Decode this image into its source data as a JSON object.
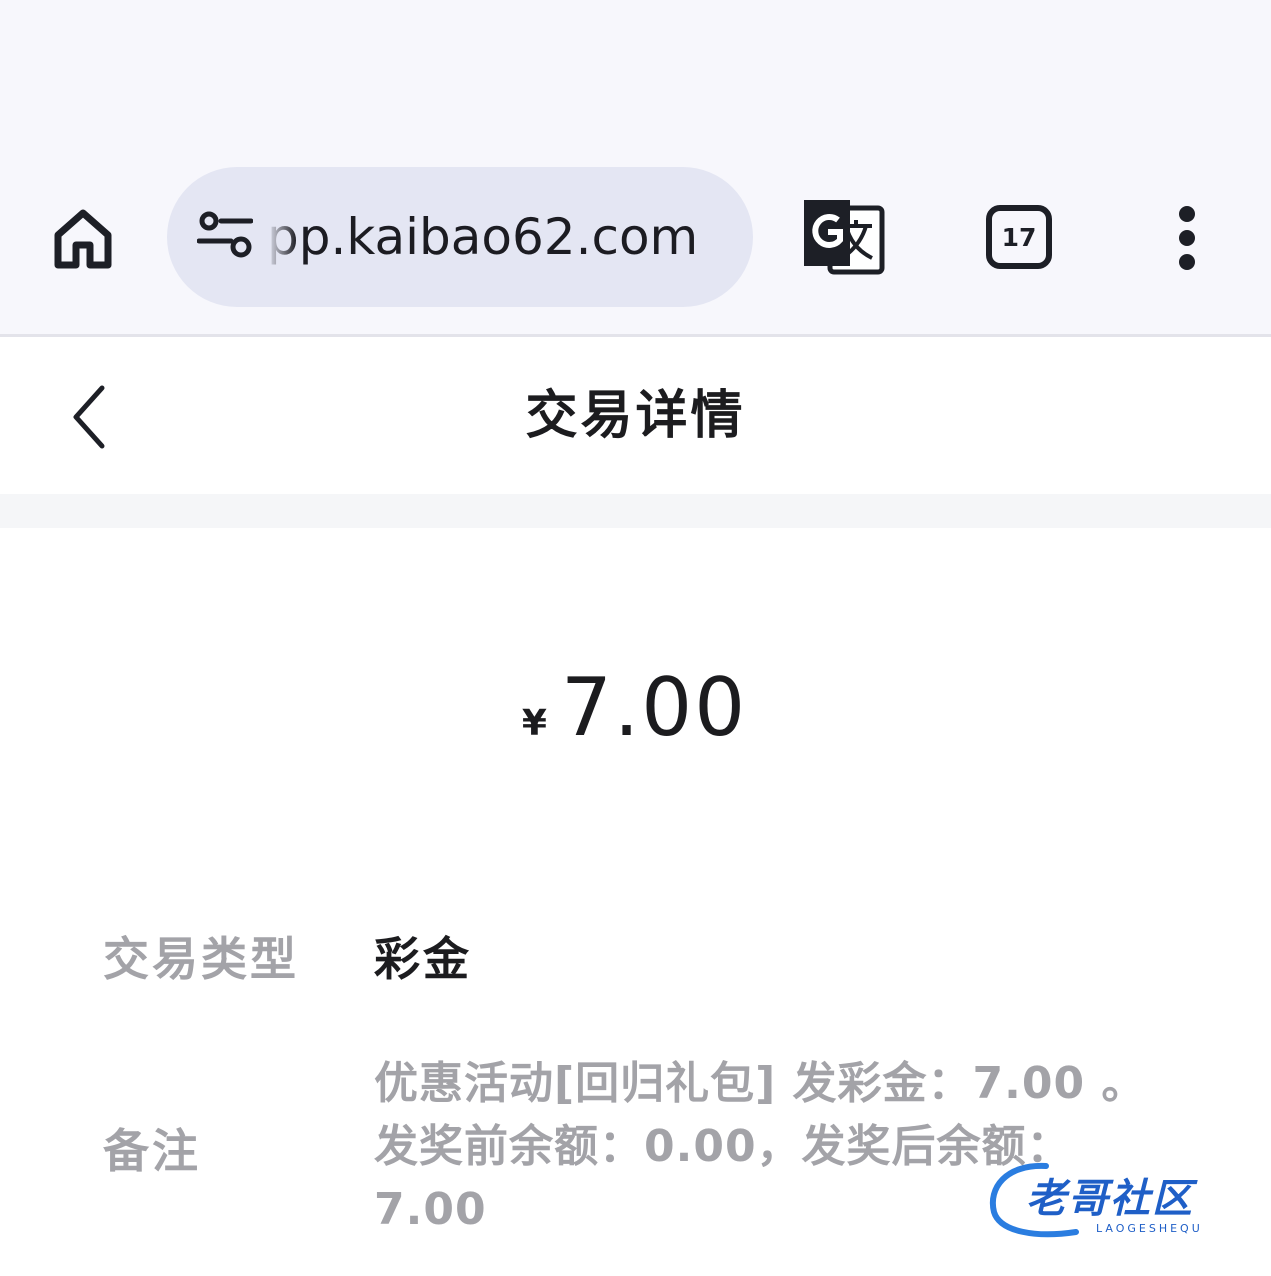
{
  "browser": {
    "url": "pp.kaibao62.com",
    "tab_count": "17",
    "icons": {
      "home": "home-icon",
      "site_settings": "tune-icon",
      "translate": "translate-icon",
      "tabs": "tab-switcher-icon",
      "menu": "more-vert-icon"
    }
  },
  "header": {
    "title": "交易详情",
    "back_icon": "chevron-left-icon"
  },
  "amount": {
    "currency": "¥",
    "value": "7.00"
  },
  "details": {
    "type_label": "交易类型",
    "type_value": "彩金",
    "note_label": "备注",
    "note_lines": [
      "优惠活动[回归礼包] 发彩金：7.00 。",
      "发奖前余额：0.00，发奖后余额：",
      "7.00"
    ]
  },
  "watermark": {
    "text": "老哥社区",
    "sub": "LAOGESHEQU"
  },
  "colors": {
    "chrome_bg": "#f7f7fc",
    "url_pill": "#e4e6f3",
    "text_primary": "#1c1c1f",
    "text_secondary": "#a3a3a8",
    "divider": "#f5f6f8",
    "watermark": "#1f5fc7"
  }
}
